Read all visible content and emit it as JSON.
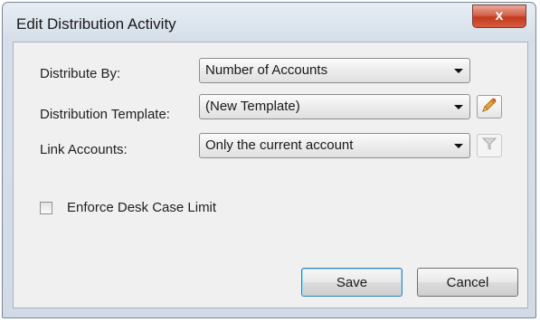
{
  "window": {
    "title": "Edit Distribution Activity",
    "close_symbol": "x"
  },
  "fields": {
    "distribute_by": {
      "label": "Distribute By:",
      "value": "Number of Accounts"
    },
    "distribution_template": {
      "label": "Distribution Template:",
      "value": "(New Template)",
      "edit_icon": "pencil-icon"
    },
    "link_accounts": {
      "label": "Link Accounts:",
      "value": "Only the current account",
      "filter_icon": "funnel-icon"
    }
  },
  "options": {
    "enforce_desk_case_limit": {
      "label": "Enforce Desk Case Limit",
      "checked": false
    }
  },
  "buttons": {
    "save_label": "Save",
    "cancel_label": "Cancel"
  },
  "colors": {
    "close_button": "#c43a1e",
    "default_button_border": "#3c7fb1",
    "pencil": "#e8a640"
  }
}
